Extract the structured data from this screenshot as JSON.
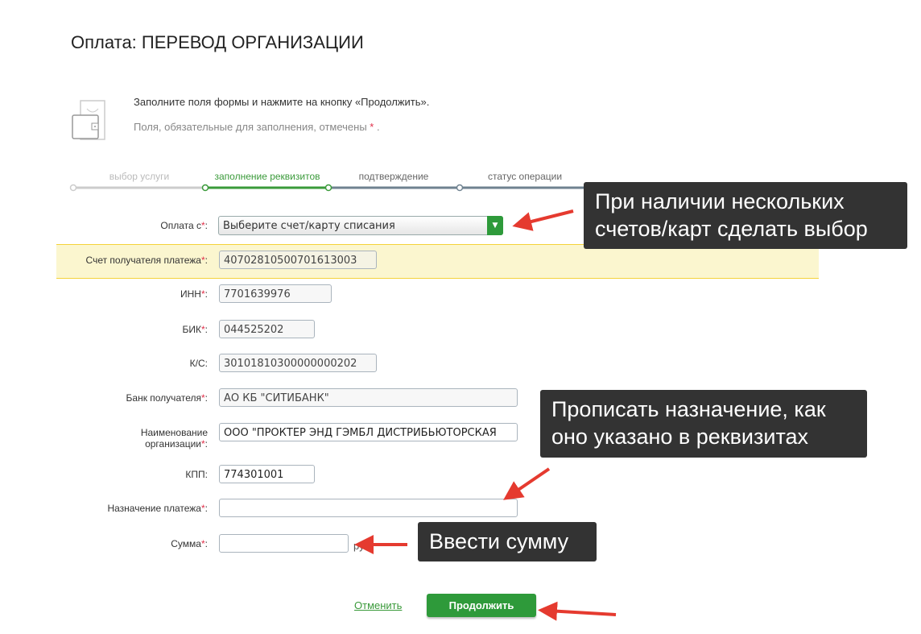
{
  "title": "Оплата: ПЕРЕВОД ОРГАНИЗАЦИИ",
  "info": {
    "line1": "Заполните поля формы и нажмите на кнопку «Продолжить».",
    "line2": "Поля, обязательные для заполнения, отмечены",
    "asterisk": "*",
    "dot": "."
  },
  "steps": [
    "выбор услуги",
    "заполнение реквизитов",
    "подтверждение",
    "статус операции"
  ],
  "form": {
    "pay_from": {
      "label": "Оплата с",
      "value": "Выберите счет/карту списания"
    },
    "account": {
      "label": "Счет получателя платежа",
      "value": "40702810500701613003"
    },
    "inn": {
      "label": "ИНН",
      "value": "7701639976"
    },
    "bik": {
      "label": "БИК",
      "value": "044525202"
    },
    "ks": {
      "label": "К/С:",
      "value": "30101810300000000202"
    },
    "bank": {
      "label": "Банк получателя",
      "value": "АО КБ \"СИТИБАНК\""
    },
    "org": {
      "label1": "Наименование",
      "label2": "организации",
      "value": "ООО \"ПРОКТЕР ЭНД ГЭМБЛ ДИСТРИБЬЮТОРСКАЯ"
    },
    "kpp": {
      "label": "КПП:",
      "value": "774301001"
    },
    "purpose": {
      "label": "Назначение платежа",
      "value": ""
    },
    "amount": {
      "label": "Сумма",
      "value": "",
      "currency": "руб."
    },
    "req": "*",
    "colon": ":"
  },
  "buttons": {
    "cancel": "Отменить",
    "continue": "Продолжить"
  },
  "callouts": {
    "c1a": "При наличии нескольких",
    "c1b": "счетов/карт сделать выбор",
    "c2a": "Прописать назначение, как",
    "c2b": "оно указано в реквизитах",
    "c3": "Ввести сумму"
  },
  "colors": {
    "green": "#2e9a3a",
    "req": "#e0304a",
    "arrow": "#e53a2f"
  }
}
